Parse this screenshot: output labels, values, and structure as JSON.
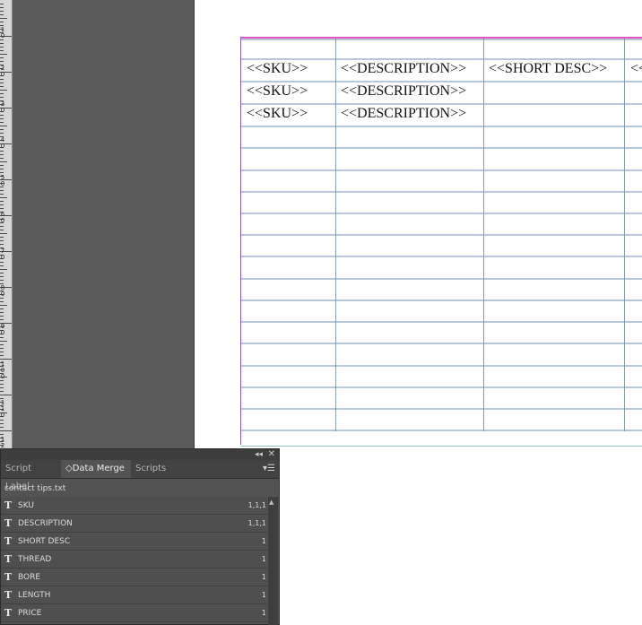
{
  "ruler": {
    "labels": [
      "1\n0",
      "2\n0",
      "3\n0",
      "4\n0",
      "5\n0",
      "6\n0",
      "7\n0",
      "8\n0",
      "9\n0",
      "1\n0\n0",
      "1\n1\n0",
      "1\n2"
    ]
  },
  "table": {
    "rows": [
      [
        "",
        "",
        "",
        ""
      ],
      [
        "<<SKU>>",
        "<<DESCRIPTION>>",
        "<<SHORT DESC>>",
        "<<"
      ],
      [
        "<<SKU>>",
        "<<DESCRIPTION>>",
        "",
        ""
      ],
      [
        "<<SKU>>",
        "<<DESCRIPTION>>",
        "",
        ""
      ]
    ]
  },
  "panel": {
    "tabs": [
      {
        "label": "Script Label",
        "active": false
      },
      {
        "label": "◇Data Merge",
        "active": true
      },
      {
        "label": "Scripts",
        "active": false
      }
    ],
    "source_file": "contact tips.txt",
    "fields": [
      {
        "icon": "T",
        "name": "SKU",
        "value": "1,1,1"
      },
      {
        "icon": "T",
        "name": "DESCRIPTION",
        "value": "1,1,1"
      },
      {
        "icon": "T",
        "name": "SHORT DESC",
        "value": "1"
      },
      {
        "icon": "T",
        "name": "THREAD",
        "value": "1"
      },
      {
        "icon": "T",
        "name": "BORE",
        "value": "1"
      },
      {
        "icon": "T",
        "name": "LENGTH",
        "value": "1"
      },
      {
        "icon": "T",
        "name": "PRICE",
        "value": "1"
      }
    ],
    "collapse_icon": "double-chevron-left-icon",
    "close_icon": "close-icon",
    "menu_icon": "panel-menu-icon"
  },
  "colors": {
    "pasteboard": "#5b5b5b",
    "panel_bg": "#535353",
    "frame_top": "#e058c8",
    "frame_left": "#8a5cd6",
    "grid_line": "#b8c8dc"
  }
}
